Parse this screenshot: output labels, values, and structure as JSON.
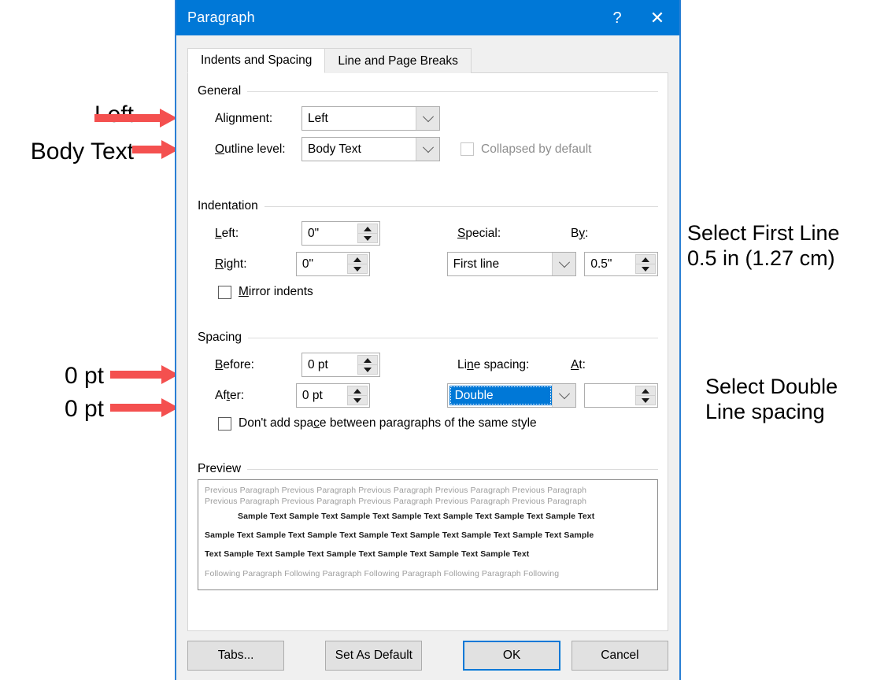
{
  "window": {
    "title": "Paragraph",
    "help_button": "?",
    "close_button": "✕"
  },
  "tabs": [
    {
      "label": "Indents and Spacing",
      "accel": "I",
      "active": true
    },
    {
      "label": "Line and Page Breaks",
      "accel": "P",
      "active": false
    }
  ],
  "general": {
    "group_label": "General",
    "alignment_label": "Alignment:",
    "alignment_value": "Left",
    "outline_label": "Outline level:",
    "outline_value": "Body Text",
    "collapsed_label": "Collapsed by default",
    "collapsed_checked": false,
    "collapsed_disabled": true
  },
  "indentation": {
    "group_label": "Indentation",
    "left_label": "Left:",
    "left_value": "0\"",
    "right_label": "Right:",
    "right_value": "0\"",
    "special_label": "Special:",
    "special_value": "First line",
    "by_label": "By:",
    "by_value": "0.5\"",
    "mirror_label": "Mirror indents",
    "mirror_checked": false
  },
  "spacing": {
    "group_label": "Spacing",
    "before_label": "Before:",
    "before_value": "0 pt",
    "after_label": "After:",
    "after_value": "0 pt",
    "line_spacing_label": "Line spacing:",
    "line_spacing_value": "Double",
    "line_spacing_selected": true,
    "at_label": "At:",
    "at_value": "",
    "dont_add_space_label": "Don't add space between paragraphs of the same style",
    "dont_add_space_checked": false
  },
  "preview": {
    "group_label": "Preview",
    "prev_line_1": "Previous Paragraph Previous Paragraph Previous Paragraph Previous Paragraph Previous Paragraph",
    "prev_line_2": "Previous Paragraph Previous Paragraph Previous Paragraph Previous Paragraph Previous Paragraph",
    "sample_line_1": "Sample Text Sample Text Sample Text Sample Text Sample Text Sample Text Sample Text",
    "sample_line_2": "Sample Text Sample Text Sample Text Sample Text Sample Text Sample Text Sample Text Sample",
    "sample_line_3": "Text Sample Text Sample Text Sample Text Sample Text Sample Text Sample Text",
    "following_line": "Following Paragraph Following Paragraph Following Paragraph Following Paragraph Following"
  },
  "footer": {
    "tabs_label": "Tabs...",
    "set_default_label": "Set As Default",
    "ok_label": "OK",
    "cancel_label": "Cancel"
  },
  "annotations": {
    "arrow_color": "#F4504F",
    "left": [
      {
        "text": "Left"
      },
      {
        "text": "Body Text"
      },
      {
        "text": "0 pt"
      },
      {
        "text": "0 pt"
      }
    ],
    "right": [
      {
        "line1": "Select First Line",
        "line2": "0.5 in (1.27 cm)"
      },
      {
        "line1": "Select Double",
        "line2": "Line spacing"
      }
    ]
  }
}
